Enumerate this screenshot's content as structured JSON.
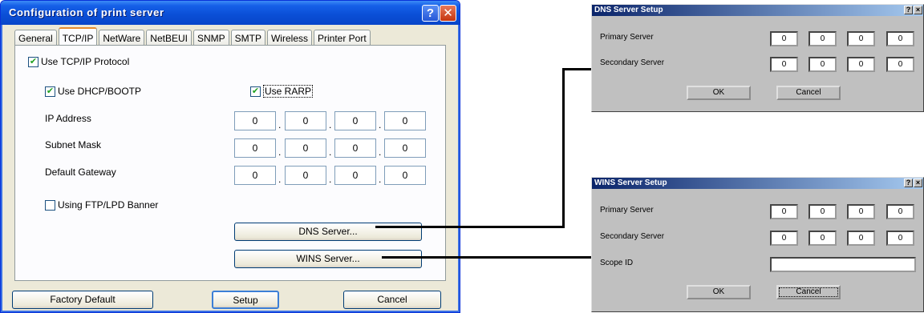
{
  "main_dialog": {
    "title": "Configuration of print server",
    "help_glyph": "?",
    "close_glyph": "✕",
    "tabs": [
      "General",
      "TCP/IP",
      "NetWare",
      "NetBEUI",
      "SNMP",
      "SMTP",
      "Wireless",
      "Printer Port"
    ],
    "active_tab": "TCP/IP",
    "use_tcpip_label": "Use TCP/IP Protocol",
    "use_tcpip_checked": true,
    "use_dhcp_label": "Use DHCP/BOOTP",
    "use_dhcp_checked": true,
    "use_rarp_label": "Use RARP",
    "use_rarp_checked": true,
    "ip_address_label": "IP Address",
    "ip_address": [
      "0",
      "0",
      "0",
      "0"
    ],
    "subnet_mask_label": "Subnet Mask",
    "subnet_mask": [
      "0",
      "0",
      "0",
      "0"
    ],
    "default_gateway_label": "Default Gateway",
    "default_gateway": [
      "0",
      "0",
      "0",
      "0"
    ],
    "ftp_banner_label": "Using FTP/LPD Banner",
    "ftp_banner_checked": false,
    "dns_button": "DNS Server...",
    "wins_button": "WINS Server...",
    "factory_default_button": "Factory Default",
    "setup_button": "Setup",
    "cancel_button": "Cancel",
    "check_glyph": "✔",
    "ip_separator": "."
  },
  "dns_dialog": {
    "title": "DNS Server Setup",
    "help_glyph": "?",
    "close_glyph": "×",
    "primary_label": "Primary Server",
    "primary": [
      "0",
      "0",
      "0",
      "0"
    ],
    "secondary_label": "Secondary Server",
    "secondary": [
      "0",
      "0",
      "0",
      "0"
    ],
    "ok_button": "OK",
    "cancel_button": "Cancel"
  },
  "wins_dialog": {
    "title": "WINS Server Setup",
    "help_glyph": "?",
    "close_glyph": "×",
    "primary_label": "Primary Server",
    "primary": [
      "0",
      "0",
      "0",
      "0"
    ],
    "secondary_label": "Secondary Server",
    "secondary": [
      "0",
      "0",
      "0",
      "0"
    ],
    "scope_label": "Scope ID",
    "scope_value": "",
    "ok_button": "OK",
    "cancel_button": "Cancel"
  },
  "colors": {
    "xp_title": "#0a4ed6",
    "xp_face": "#ece9d8",
    "classic_face": "#c0c0c0",
    "classic_title": "#0a246a",
    "connector": "#000000"
  }
}
